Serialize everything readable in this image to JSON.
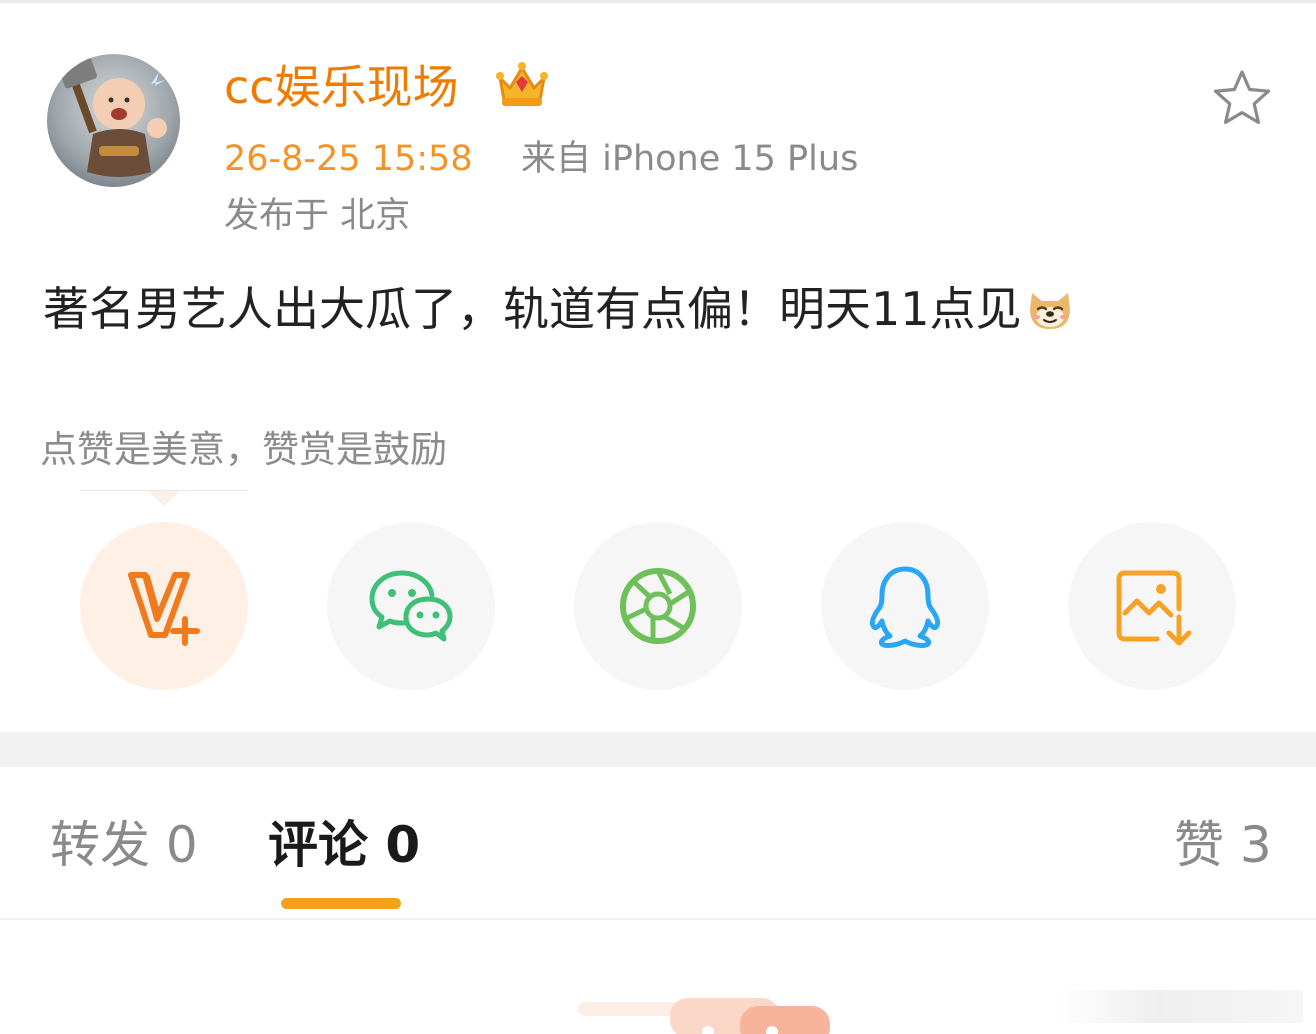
{
  "post": {
    "username": "cc娱乐现场",
    "time": "26-8-25 15:58",
    "source": "来自 iPhone 15 Plus",
    "location": "发布于 北京",
    "text": "著名男艺人出大瓜了，轨道有点偏！明天11点见",
    "avatar_icon": "baby-thor-avatar",
    "badge_icon": "crown-icon",
    "favorite_icon": "star-icon",
    "emoji_icon": "doge-emoji-icon"
  },
  "reward_hint": "点赞是美意，赞赏是鼓励",
  "share_buttons": [
    {
      "name": "vplus",
      "icon": "v-plus-icon",
      "color": "#f07b1f"
    },
    {
      "name": "wechat",
      "icon": "wechat-icon",
      "color": "#3fbf7a"
    },
    {
      "name": "moments",
      "icon": "moments-aperture-icon",
      "color": "#6fc05a"
    },
    {
      "name": "qq",
      "icon": "qq-penguin-icon",
      "color": "#2aa6f2"
    },
    {
      "name": "save-image",
      "icon": "save-image-icon",
      "color": "#f7a128"
    }
  ],
  "tabs": {
    "repost": "转发 0",
    "comments": "评论 0",
    "likes": "赞 3",
    "active": "comments"
  },
  "colors": {
    "username": "#ef7c00",
    "time": "#f29427",
    "accent_tab": "#f6a11d"
  }
}
